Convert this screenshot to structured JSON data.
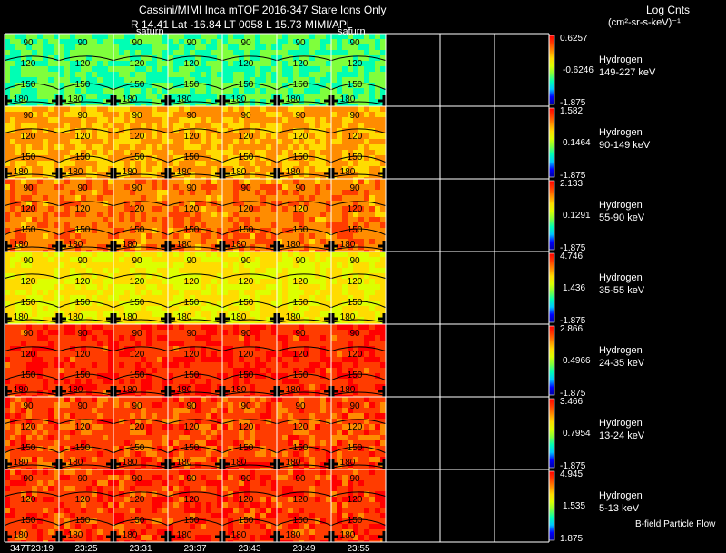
{
  "header": {
    "title": "Cassini/MIMI Inca mTOF  2016-347   Stare   Ions Only",
    "subtitle": "R         14.41  Lat -16.84  LT 0058  L             15.73  MIMI/APL",
    "legend_title": "Log Cnts",
    "legend_units": "(cm²-sr-s-keV)⁻¹"
  },
  "footer": {
    "bfield": "B-field  Particle Flow"
  },
  "chart_data": {
    "type": "heatmap",
    "x_ticks": [
      "347T23:19",
      "23:25",
      "23:31",
      "23:37",
      "23:43",
      "23:49",
      "23:55"
    ],
    "polar_labels": [
      "90",
      "120",
      "150",
      "180"
    ],
    "saturn_label": "saturn",
    "colormap": [
      "#0000a0",
      "#0000ff",
      "#00c8ff",
      "#00ffb4",
      "#7fff3c",
      "#dcff00",
      "#ffdc00",
      "#ff8c00",
      "#ff3c00",
      "#ff0000"
    ],
    "rows": [
      {
        "species": "Hydrogen",
        "energy": "149-227 keV",
        "cbar_max": "0.6257",
        "cbar_mid": "-0.6246",
        "cbar_min": "-1.875",
        "level": 0.4,
        "data_panels": 7
      },
      {
        "species": "Hydrogen",
        "energy": "90-149 keV",
        "cbar_max": "1.582",
        "cbar_mid": "0.1464",
        "cbar_min": "-1.875",
        "level": 0.74,
        "data_panels": 7
      },
      {
        "species": "Hydrogen",
        "energy": "55-90 keV",
        "cbar_max": "2.133",
        "cbar_mid": "0.1291",
        "cbar_min": "-1.875",
        "level": 0.8,
        "data_panels": 7
      },
      {
        "species": "Hydrogen",
        "energy": "35-55 keV",
        "cbar_max": "4.746",
        "cbar_mid": "1.436",
        "cbar_min": "-1.875",
        "level": 0.62,
        "data_panels": 7
      },
      {
        "species": "Hydrogen",
        "energy": "24-35 keV",
        "cbar_max": "2.866",
        "cbar_mid": "0.4966",
        "cbar_min": "-1.875",
        "level": 0.92,
        "data_panels": 7
      },
      {
        "species": "Hydrogen",
        "energy": "13-24 keV",
        "cbar_max": "3.466",
        "cbar_mid": "0.7954",
        "cbar_min": "-1.875",
        "level": 0.88,
        "data_panels": 7
      },
      {
        "species": "Hydrogen",
        "energy": "5-13 keV",
        "cbar_max": "4.945",
        "cbar_mid": "1.535",
        "cbar_min": "1.875",
        "level": 0.9,
        "data_panels": 7
      }
    ]
  }
}
